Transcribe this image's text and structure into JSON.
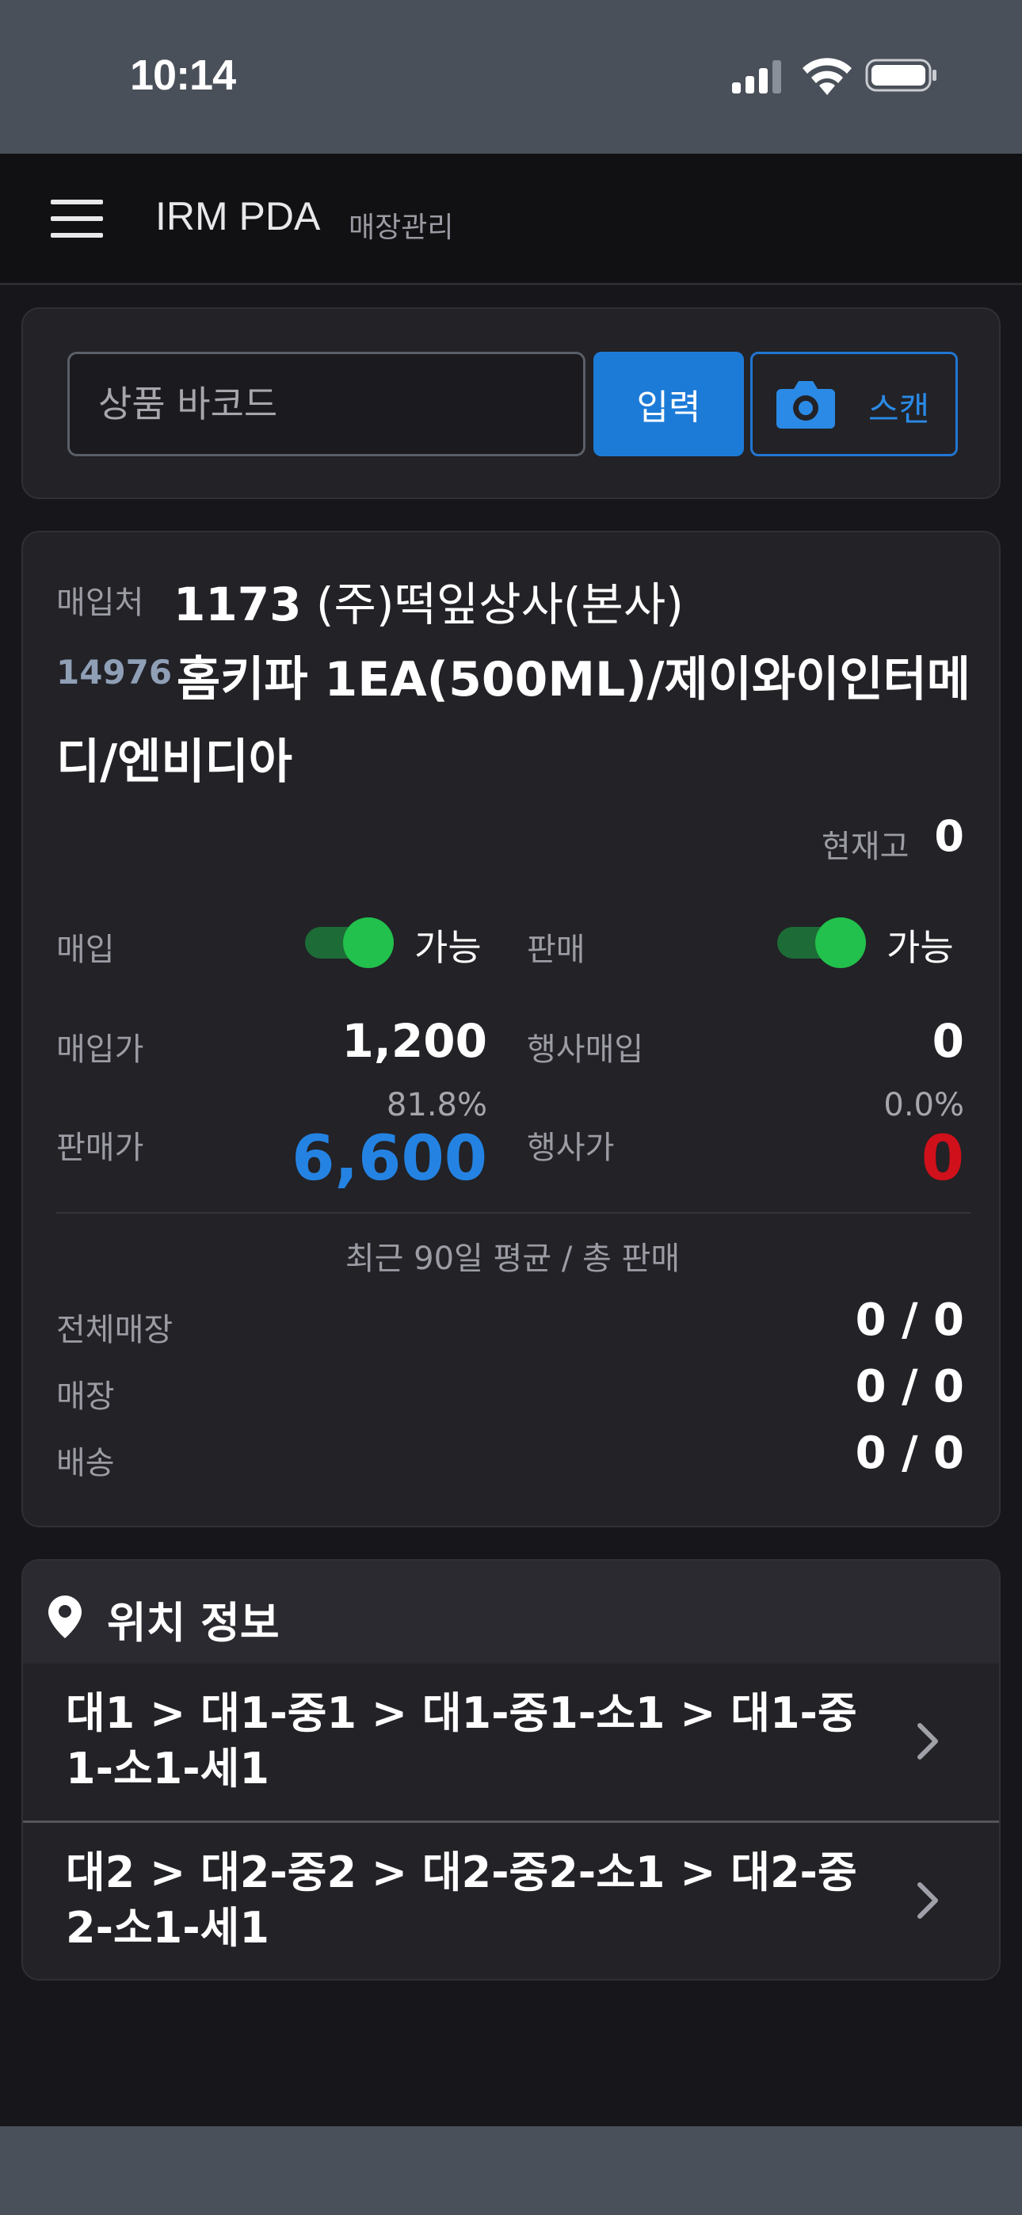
{
  "status_bar": {
    "time": "10:14"
  },
  "app_bar": {
    "title": "IRM PDA",
    "subtitle": "매장관리"
  },
  "search": {
    "placeholder": "상품 바코드",
    "enter_label": "입력",
    "scan_label": "스캔"
  },
  "product": {
    "supplier_label": "매입처",
    "supplier_code": "1173",
    "supplier_name": "(주)떡잎상사(본사)",
    "product_code": "14976",
    "product_name": "홈키파 1EA(500ML)/제이와이인터메디/엔비디아",
    "stock_label": "현재고",
    "stock_value": "0",
    "purchase_label": "매입",
    "purchase_status": "가능",
    "purchase_enabled": true,
    "sale_label": "판매",
    "sale_status": "가능",
    "sale_enabled": true,
    "purchase_price_label": "매입가",
    "purchase_price": "1,200",
    "event_purchase_label": "행사매입",
    "event_purchase": "0",
    "sale_margin": "81.8%",
    "sale_price_label": "판매가",
    "sale_price": "6,600",
    "event_margin": "0.0%",
    "event_price_label": "행사가",
    "event_price": "0",
    "sale_price_color": "#2483e2",
    "event_price_color": "#d0101a"
  },
  "sales_stats": {
    "title": "최근 90일 평균 / 총 판매",
    "rows": [
      {
        "label": "전체매장",
        "value": "0 / 0"
      },
      {
        "label": "매장",
        "value": "0 / 0"
      },
      {
        "label": "배송",
        "value": "0 / 0"
      }
    ]
  },
  "location": {
    "title": "위치 정보",
    "items": [
      {
        "path": "대1 > 대1-중1 > 대1-중1-소1 > 대1-중1-소1-세1"
      },
      {
        "path": "대2 > 대2-중2 > 대2-중2-소1 > 대2-중2-소1-세1"
      }
    ]
  },
  "colors": {
    "accent": "#1d7bd8",
    "toggle_on": "#22c04c",
    "background": "#17171b"
  }
}
